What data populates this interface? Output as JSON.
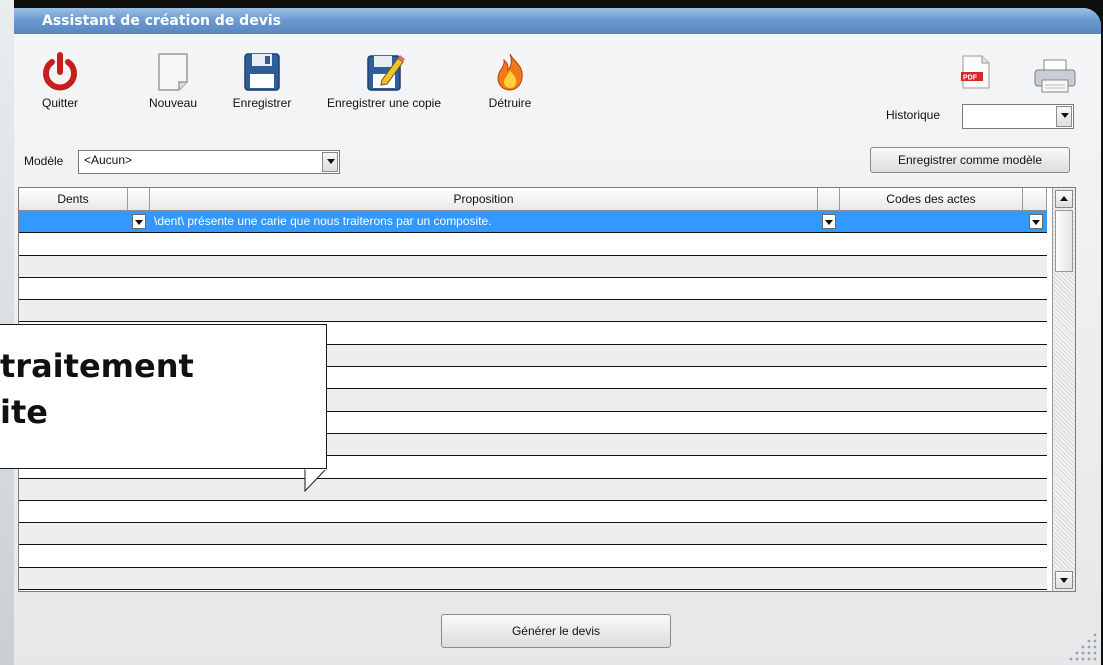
{
  "window": {
    "title": "Assistant de création de devis"
  },
  "toolbar": {
    "quit_label": "Quitter",
    "new_label": "Nouveau",
    "save_label": "Enregistrer",
    "save_copy_label": "Enregistrer une copie",
    "destroy_label": "Détruire"
  },
  "history": {
    "label": "Historique",
    "value": ""
  },
  "model": {
    "label": "Modèle",
    "value": "<Aucun>",
    "save_as_model_label": "Enregistrer comme modèle"
  },
  "grid": {
    "headers": [
      "Dents",
      "Proposition",
      "Codes des actes"
    ],
    "selected_row": {
      "dents": "",
      "proposition": "\\dent\\ présente une carie que nous traiterons par un composite.",
      "codes": ""
    }
  },
  "footer": {
    "generate_label": "Générer le devis"
  },
  "callout": {
    "text": "traitement\nite"
  },
  "colors": {
    "titlebar": "#6c9ad0",
    "selection": "#3399ff",
    "quit_icon": "#c61d1d"
  }
}
